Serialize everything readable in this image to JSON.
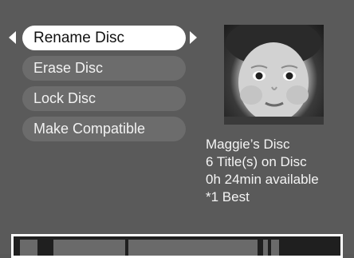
{
  "menu": {
    "items": [
      {
        "label": "Rename Disc",
        "selected": true
      },
      {
        "label": "Erase Disc",
        "selected": false
      },
      {
        "label": "Lock Disc",
        "selected": false
      },
      {
        "label": "Make Compatible",
        "selected": false
      }
    ]
  },
  "disc_info": {
    "name": "Maggie’s Disc",
    "titles": "6 Title(s) on Disc",
    "available": "0h 24min available",
    "quality": "*1 Best"
  },
  "thumbnail": {
    "icon": "baby-photo"
  },
  "colors": {
    "background": "#5a5a5a",
    "selected_item": "#ffffff",
    "unselected_item": "#6c6c6c",
    "text": "#f4f4f4"
  }
}
